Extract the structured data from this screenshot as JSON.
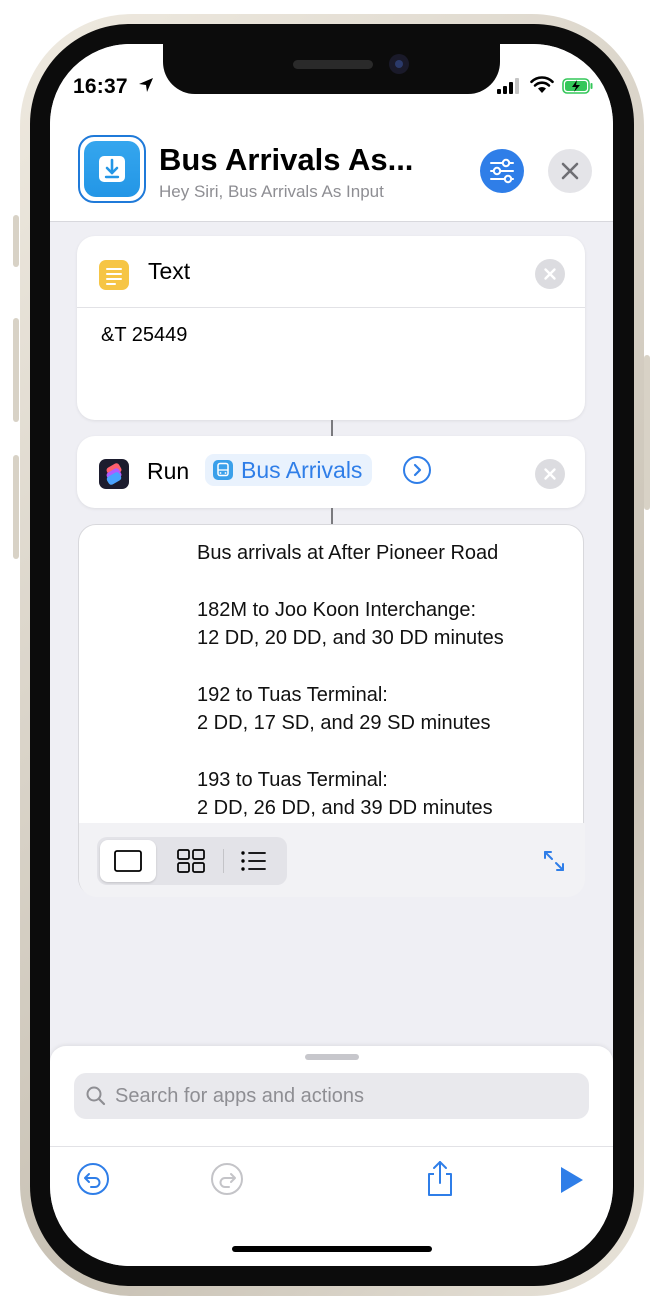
{
  "status_bar": {
    "time": "16:37",
    "icons": [
      "location-arrow-icon",
      "cellular-signal-icon",
      "wifi-icon",
      "battery-charging-icon"
    ]
  },
  "header": {
    "title": "Bus Arrivals As...",
    "subtitle": "Hey Siri, Bus Arrivals As Input",
    "icons": [
      "shortcut-download-icon",
      "settings-sliders-icon",
      "close-icon"
    ]
  },
  "actions": {
    "text_action": {
      "title": "Text",
      "body": "&T 25449"
    },
    "run_action": {
      "title": "Run",
      "shortcut_name": "Bus Arrivals"
    }
  },
  "output": {
    "lines": [
      "Bus arrivals at After Pioneer Road",
      "182M to Joo Koon Interchange:",
      "12 DD, 20 DD, and 30 DD minutes",
      "192 to Tuas Terminal:",
      "2 DD, 17 SD, and 29 SD minutes",
      "193 to Tuas Terminal:",
      "2 DD, 26 DD, and 39 DD minutes"
    ],
    "view_modes": [
      "single-view-icon",
      "grid-view-icon",
      "list-view-icon"
    ],
    "selected_view": "single-view-icon"
  },
  "search": {
    "placeholder": "Search for apps and actions"
  },
  "bottom_toolbar": {
    "icons": [
      "undo-icon",
      "redo-icon",
      "share-icon",
      "play-icon"
    ]
  },
  "colors": {
    "accent": "#2f7ee8",
    "text_icon": "#f6c545",
    "background": "#efeff4"
  }
}
